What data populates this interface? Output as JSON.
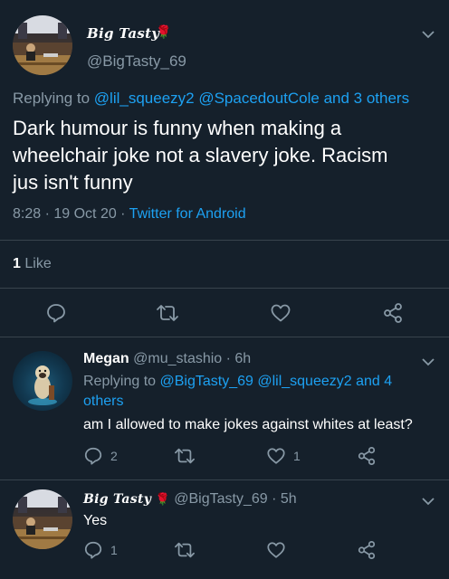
{
  "main_tweet": {
    "display_name": "Big Tasty",
    "handle": "@BigTasty_69",
    "emoji": "🌹",
    "replying_prefix": "Replying to",
    "replying_to": "@lil_squeezy2 @SpacedoutCole and 3 others",
    "text_line1": "Dark humour is funny when making a",
    "text_line2": "wheelchair joke not a slavery joke. Racism",
    "text_line3": "jus isn't funny",
    "time": "8:28 · 19 Oct 20 ·",
    "source": "Twitter for Android",
    "likes_count": "1",
    "likes_label": "Like"
  },
  "reply1": {
    "display_name": "Megan",
    "handle_time": "@mu_stashio · 6h",
    "replying_prefix": "Replying to",
    "replying_to_line1": "@BigTasty_69 @lil_squeezy2 and 4",
    "replying_to_line2": "others",
    "text": "am I allowed to make jokes against whites at least?",
    "reply_count": "2",
    "like_count": "1"
  },
  "reply2": {
    "display_name": "Big Tasty",
    "emoji": "🌹",
    "handle_time": "@BigTasty_69 · 5h",
    "text": "Yes",
    "reply_count": "1"
  },
  "colors": {
    "background": "#15202b",
    "accent": "#1da1f2",
    "muted": "#8899a6",
    "divider": "#38444d"
  },
  "icons": [
    "chevron-down-icon",
    "reply-icon",
    "retweet-icon",
    "like-icon",
    "share-icon"
  ]
}
